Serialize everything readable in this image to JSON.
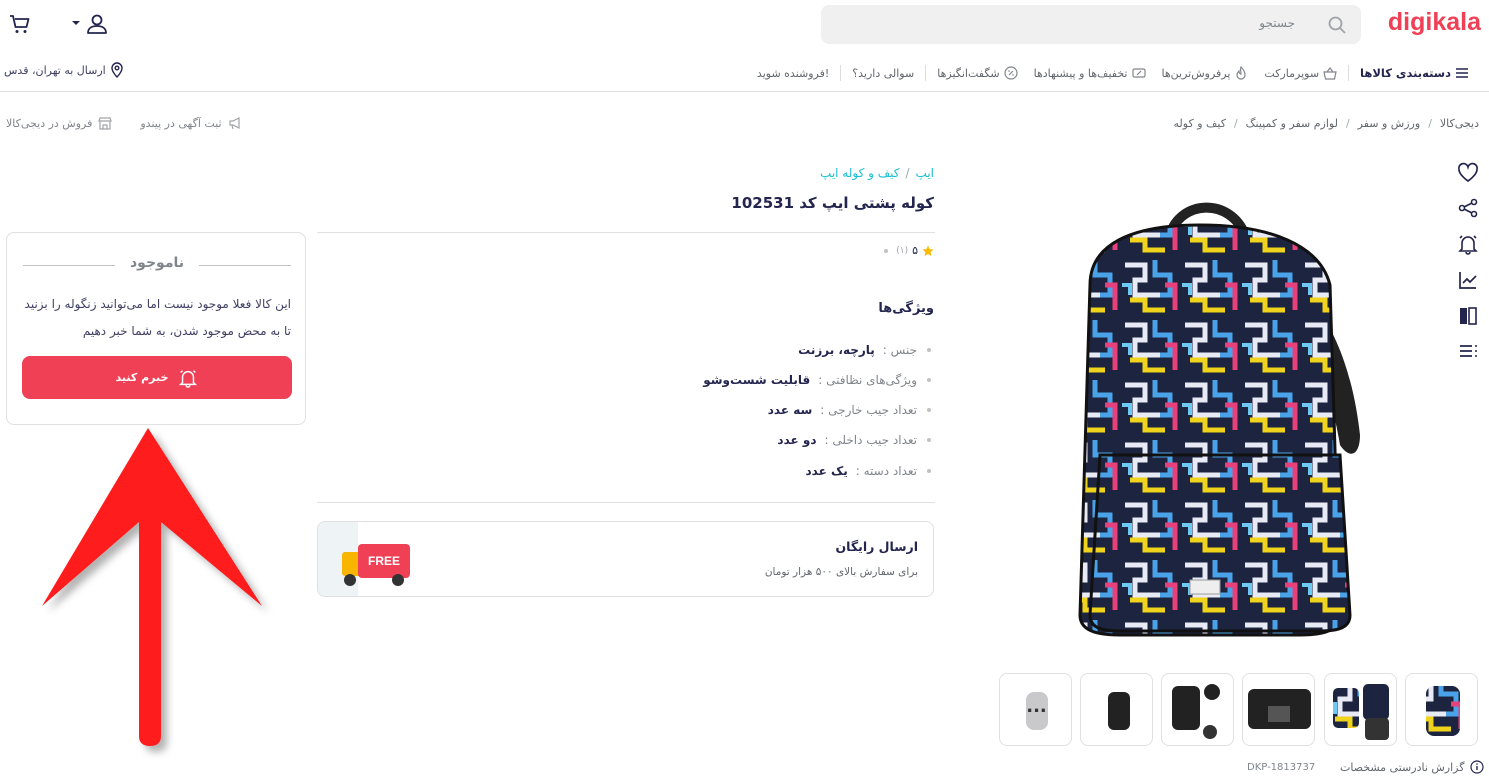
{
  "header": {
    "logo": "digikala",
    "search_placeholder": "جستجو",
    "icons": [
      "search-icon",
      "cart-icon",
      "user-icon",
      "caret-down-icon"
    ]
  },
  "nav": {
    "items": [
      {
        "label": "دسته‌بندی کالاها",
        "icon": "menu-icon"
      },
      {
        "label": "سوپرمارکت",
        "icon": "basket-icon"
      },
      {
        "label": "پرفروش‌ترین‌ها",
        "icon": "fire-icon"
      },
      {
        "label": "تخفیف‌ها و پیشنهادها",
        "icon": "discount-icon"
      },
      {
        "label": "شگفت‌انگیزها",
        "icon": "percent-icon"
      },
      {
        "label": "سوالی دارید؟",
        "icon": ""
      },
      {
        "label": "فروشنده شوید!",
        "icon": ""
      }
    ],
    "ship_to": "ارسال به تهران، قدس"
  },
  "breadcrumb": [
    "دیجی‌کالا",
    "ورزش و سفر",
    "لوازم سفر و کمپینگ",
    "کیف و کوله"
  ],
  "seller_links": {
    "sell": "فروش در دیجی‌کالا",
    "ad": "ثبت آگهی در پیندو"
  },
  "product": {
    "brand": "ایپ",
    "category": "کیف و کوله ایپ",
    "title": "کوله پشتی ایپ کد 102531",
    "rating": "۵",
    "rating_count": "(۱)",
    "features_title": "ویژگی‌ها",
    "features": [
      {
        "label": "جنس :",
        "value": "پارچه، برزنت"
      },
      {
        "label": "ویژگی‌های نظافتی :",
        "value": "قابلیت شست‌وشو"
      },
      {
        "label": "تعداد جیب خارجی :",
        "value": "سه عدد"
      },
      {
        "label": "تعداد جیب داخلی :",
        "value": "دو عدد"
      },
      {
        "label": "تعداد دسته :",
        "value": "یک عدد"
      }
    ],
    "free_shipping": {
      "title": "ارسال رایگان",
      "subtitle": "برای سفارش بالای ۵۰۰ هزار تومان",
      "badge": "FREE"
    },
    "side_tools": [
      "heart-icon",
      "share-icon",
      "bell-icon",
      "chart-icon",
      "compare-icon",
      "list-icon"
    ],
    "thumbs_more": "...",
    "report": "گزارش نادرستی مشخصات",
    "dkp": "DKP-1813737"
  },
  "stock_box": {
    "status": "ناموجود",
    "message": "این کالا فعلا موجود نیست اما می‌توانید زنگوله را بزنید تا به محض موجود شدن، به شما خبر دهیم",
    "button": "خبرم کنید"
  },
  "colors": {
    "brand_red": "#ef4056",
    "link_cyan": "#19bfd3",
    "arrow_red": "#ff1a1a"
  }
}
